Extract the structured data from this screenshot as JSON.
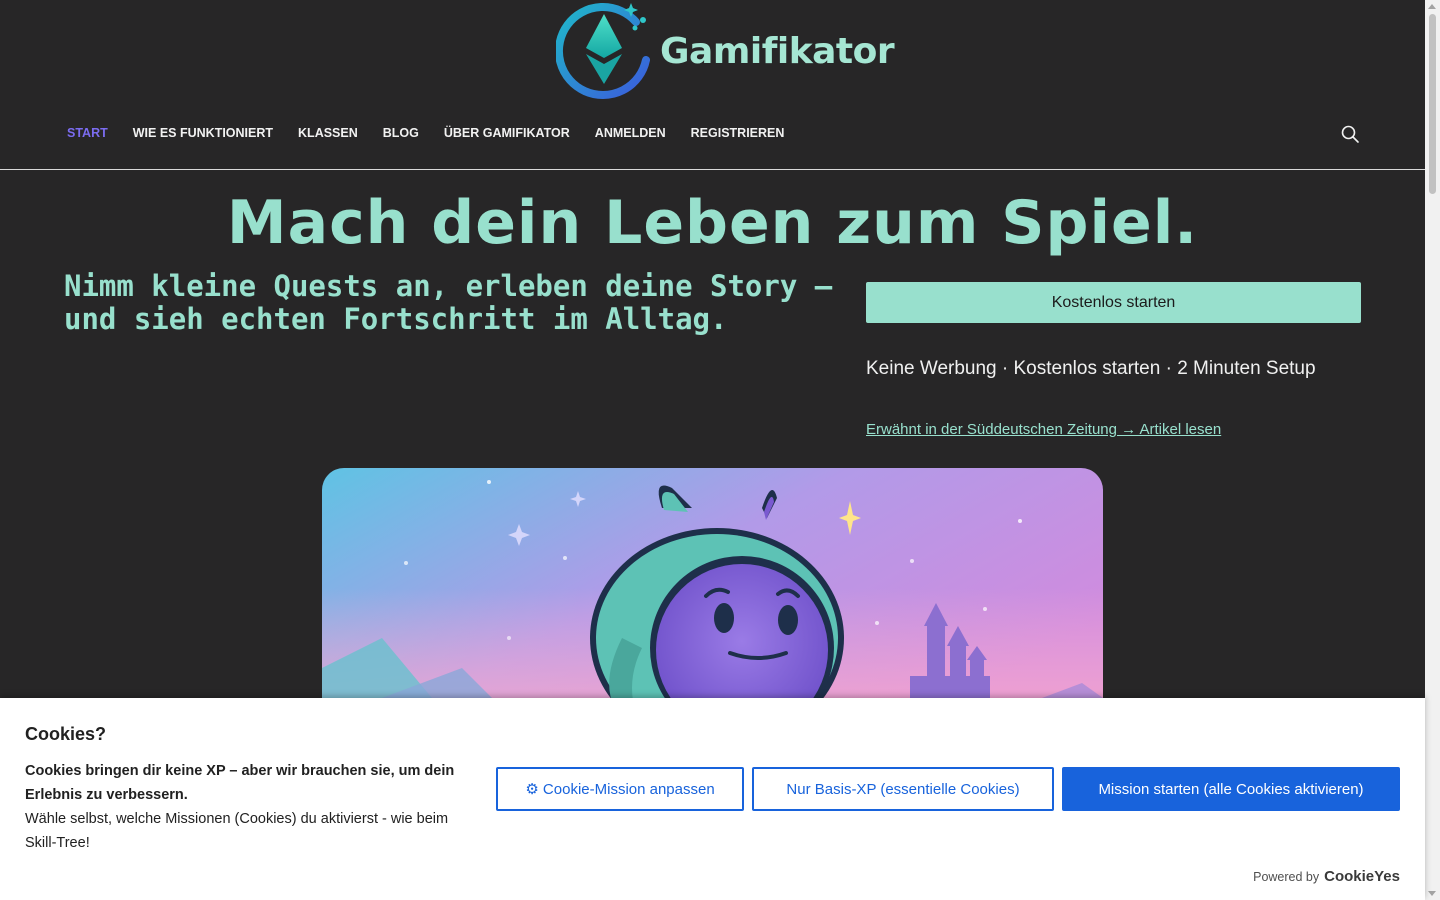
{
  "header": {
    "logo_text": "Gamifikator",
    "nav": [
      {
        "label": "START",
        "active": true
      },
      {
        "label": "WIE ES FUNKTIONIERT"
      },
      {
        "label": "KLASSEN"
      },
      {
        "label": "BLOG"
      },
      {
        "label": "ÜBER GAMIFIKATOR"
      },
      {
        "label": "ANMELDEN"
      },
      {
        "label": "REGISTRIEREN"
      }
    ]
  },
  "hero": {
    "title": "Mach dein Leben zum Spiel.",
    "subtitle": "Nimm kleine Quests an, erleben deine Story – und sieh echten Fortschritt im Alltag.",
    "cta_label": "Kostenlos starten",
    "benefits": " Keine Werbung ·  Kostenlos starten ·  2 Minuten Setup",
    "press_link": "Erwähnt in der Süddeutschen Zeitung → Artikel lesen"
  },
  "cookie": {
    "title": "Cookies?",
    "text_bold": "Cookies bringen dir keine XP – aber wir brauchen sie, um dein Erlebnis zu verbessern.",
    "text": "Wähle selbst, welche Missionen (Cookies) du aktivierst - wie beim Skill-Tree!",
    "btn_customize": "⚙ Cookie-Mission anpassen",
    "btn_essential": " Nur Basis-XP (essentielle Cookies)",
    "btn_accept": " Mission starten (alle Cookies aktivieren)",
    "powered_by": "Powered by",
    "brand": "CookieYes"
  },
  "colors": {
    "background": "#272627",
    "accent_mint": "#98e0cd",
    "nav_active": "#7b6cf0",
    "cookie_blue": "#1863dc"
  }
}
